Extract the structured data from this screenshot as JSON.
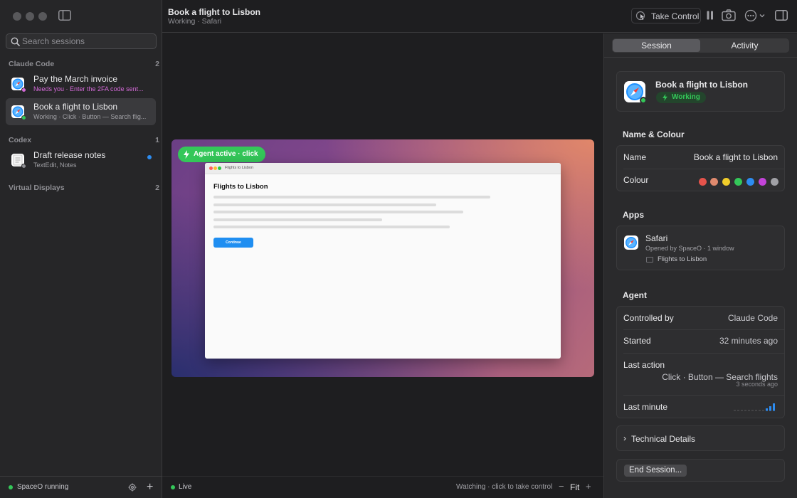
{
  "sidebar": {
    "search_placeholder": "Search sessions",
    "groups": [
      {
        "name": "Claude Code",
        "count": "2"
      },
      {
        "name": "Codex",
        "count": "1"
      },
      {
        "name": "Virtual Displays",
        "count": "2"
      }
    ],
    "sessions": [
      {
        "title": "Pay the March invoice",
        "subtitle": "Needs you · Enter the 2FA code sent...",
        "app_icon": "safari-icon",
        "status_color": "#d46ad8"
      },
      {
        "title": "Book a flight to Lisbon",
        "subtitle": "Working · Click · Button — Search flig...",
        "app_icon": "safari-icon",
        "status_color": "#34c759"
      },
      {
        "title": "Draft release notes",
        "subtitle": "TextEdit, Notes",
        "app_icon": "textedit-icon",
        "status_color": "#8e8e93"
      }
    ],
    "footer": {
      "status": "SpaceO running"
    }
  },
  "toolbar": {
    "title": "Book a flight to Lisbon",
    "subtitle": "Working · Safari",
    "take_control": "Take Control"
  },
  "main": {
    "agent_badge": "Agent active · click",
    "inner_tab": "Flights to Lisbon",
    "inner_heading": "Flights to Lisbon",
    "inner_button": "Continue",
    "footer": {
      "live": "Live",
      "watching": "Watching · click to take control",
      "zoom_out": "−",
      "fit": "Fit",
      "zoom_in": "+"
    }
  },
  "inspector": {
    "tabs": [
      {
        "label": "Session",
        "active": true
      },
      {
        "label": "Activity",
        "active": false
      }
    ],
    "session": {
      "title": "Book a flight to Lisbon",
      "status": "Working"
    },
    "name_colour": {
      "title": "Name & Colour",
      "name_label": "Name",
      "name_value": "Book a flight to Lisbon",
      "colour_label": "Colour",
      "swatches": [
        "#e5534b",
        "#e08a6e",
        "#f0cc2a",
        "#34c759",
        "#2d8cf0",
        "#c243d8",
        "#a0a0a5"
      ]
    },
    "apps": {
      "title": "Apps",
      "app_name": "Safari",
      "app_sub": "Opened by SpaceO · 1 window",
      "window": "Flights to Lisbon"
    },
    "agent": {
      "title": "Agent",
      "controlled_by_label": "Controlled by",
      "controlled_by": "Claude Code",
      "started_label": "Started",
      "started": "32 minutes ago",
      "last_action_label": "Last action",
      "last_action": "Click · Button — Search flights",
      "last_action_time": "3 seconds ago",
      "last_minute_label": "Last minute"
    },
    "technical_details": "Technical Details",
    "end_session": "End Session..."
  },
  "colors": {
    "accent_green": "#34c759",
    "accent_blue": "#2d8cf0",
    "needs_you": "#d46ad8"
  }
}
